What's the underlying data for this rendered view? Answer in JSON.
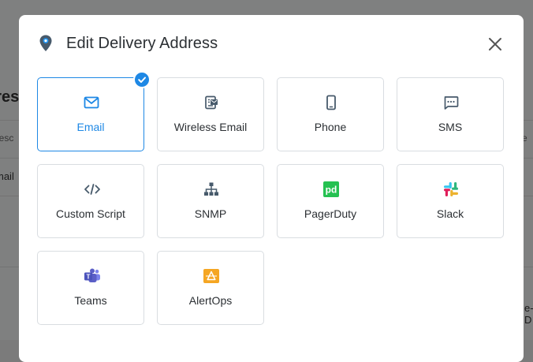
{
  "background": {
    "title": "dres",
    "column_label": "Desc",
    "cell_value": "mail",
    "right_column_label": "e",
    "right_cell_value": "e-D"
  },
  "modal": {
    "title": "Edit Delivery Address",
    "close_label": "×",
    "selected": "Email",
    "options": [
      {
        "label": "Email",
        "icon": "envelope-icon",
        "selected": true
      },
      {
        "label": "Wireless Email",
        "icon": "wireless-email-icon",
        "selected": false
      },
      {
        "label": "Phone",
        "icon": "phone-icon",
        "selected": false
      },
      {
        "label": "SMS",
        "icon": "sms-icon",
        "selected": false
      },
      {
        "label": "Custom Script",
        "icon": "code-icon",
        "selected": false
      },
      {
        "label": "SNMP",
        "icon": "network-icon",
        "selected": false
      },
      {
        "label": "PagerDuty",
        "icon": "pagerduty-icon",
        "selected": false
      },
      {
        "label": "Slack",
        "icon": "slack-icon",
        "selected": false
      },
      {
        "label": "Teams",
        "icon": "teams-icon",
        "selected": false
      },
      {
        "label": "AlertOps",
        "icon": "alertops-icon",
        "selected": false
      }
    ]
  },
  "colors": {
    "accent": "#1e88e5",
    "icon_default": "#475a6b",
    "pagerduty": "#25c151",
    "teams": "#5b5fc7",
    "alertops": "#f5a623",
    "slack_red": "#e01e5a",
    "slack_yellow": "#ecb22e",
    "slack_green": "#2eb67d",
    "slack_blue": "#36c5f0"
  }
}
